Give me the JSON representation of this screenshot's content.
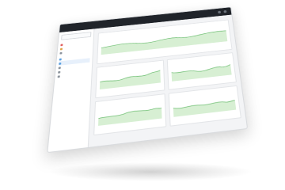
{
  "app": {
    "brand": "",
    "tabs": [
      "",
      "",
      "",
      ""
    ]
  },
  "sidebar": {
    "search_placeholder": "",
    "groups": [
      "",
      ""
    ],
    "items": [
      {
        "label": "",
        "color": "#e05d5d"
      },
      {
        "label": "",
        "color": "#e0a24a"
      },
      {
        "label": "",
        "color": "#8a929b"
      },
      {
        "label": "",
        "color": "#5aa0e0"
      },
      {
        "label": "",
        "color": "#5aa0e0"
      },
      {
        "label": "",
        "color": "#8a929b"
      },
      {
        "label": "",
        "color": "#8a929b"
      },
      {
        "label": "",
        "color": "#8a929b"
      }
    ]
  },
  "main": {
    "page_title": "",
    "panels": [
      {
        "title": "",
        "value": ""
      },
      {
        "title": "",
        "value": ""
      },
      {
        "title": "",
        "value": ""
      },
      {
        "title": "",
        "value": ""
      },
      {
        "title": "",
        "value": ""
      }
    ]
  },
  "colors": {
    "accent": "#6fbf73",
    "area": "#d7efd3",
    "topbar": "#20242a"
  }
}
